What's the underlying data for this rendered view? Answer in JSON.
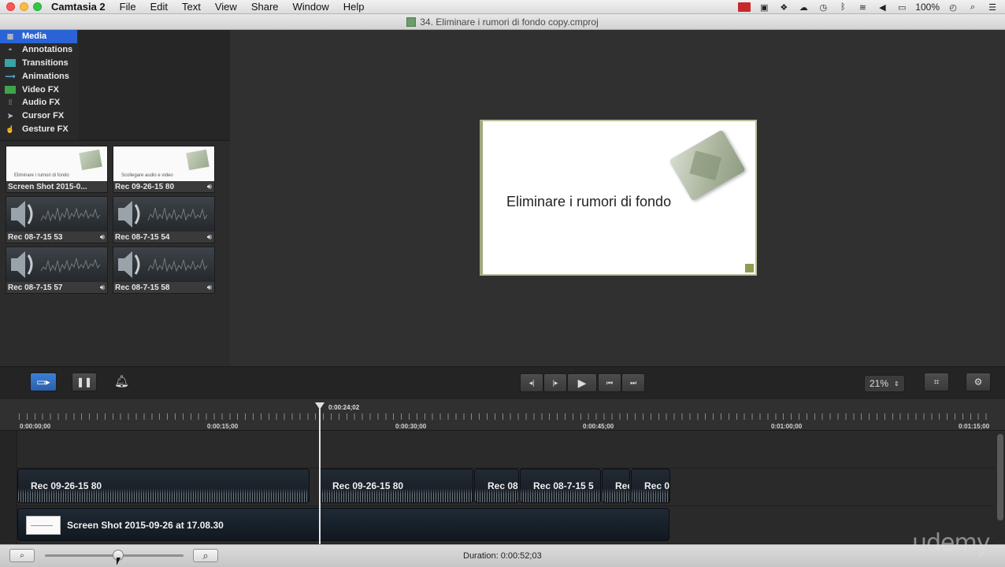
{
  "menubar": {
    "app_name": "Camtasia 2",
    "items": [
      "File",
      "Edit",
      "Text",
      "View",
      "Share",
      "Window",
      "Help"
    ],
    "battery": "100%"
  },
  "titlebar": {
    "title": "34. Eliminare i rumori di fondo copy.cmproj"
  },
  "sidebar": {
    "items": [
      {
        "label": "Media",
        "icon": "film-icon"
      },
      {
        "label": "Annotations",
        "icon": "speech-bubble-icon"
      },
      {
        "label": "Transitions",
        "icon": "transition-icon"
      },
      {
        "label": "Animations",
        "icon": "arrow-icon"
      },
      {
        "label": "Video FX",
        "icon": "video-fx-icon"
      },
      {
        "label": "Audio FX",
        "icon": "waveform-icon"
      },
      {
        "label": "Cursor FX",
        "icon": "cursor-icon"
      },
      {
        "label": "Gesture FX",
        "icon": "hand-icon"
      }
    ]
  },
  "media_bin": {
    "clips": [
      {
        "caption": "Screen Shot 2015-0...",
        "kind": "slide",
        "slide_text": "Eliminare i rumori di fondo"
      },
      {
        "caption": "Rec 09-26-15 80",
        "kind": "slide",
        "slide_text": "Scollegare audio e video"
      },
      {
        "caption": "Rec 08-7-15 53",
        "kind": "audio"
      },
      {
        "caption": "Rec 08-7-15 54",
        "kind": "audio"
      },
      {
        "caption": "Rec 08-7-15 57",
        "kind": "audio"
      },
      {
        "caption": "Rec 08-7-15 58",
        "kind": "audio"
      }
    ]
  },
  "canvas": {
    "title": "Eliminare i rumori di fondo"
  },
  "controls": {
    "zoom": "21%"
  },
  "timeline": {
    "playhead_time": "0:00:24;02",
    "ruler_labels": [
      "0:00:00;00",
      "0:00:15;00",
      "0:00:30;00",
      "0:00:45;00",
      "0:01:00;00",
      "0:01:15;00"
    ],
    "audio_clips": [
      {
        "label": "Rec 09-26-15 80"
      },
      {
        "label": "Rec 09-26-15 80"
      },
      {
        "label": "Rec 08"
      },
      {
        "label": "Rec 08-7-15 5"
      },
      {
        "label": "Rec"
      },
      {
        "label": "Rec 0"
      }
    ],
    "video_clip": {
      "label": "Screen Shot 2015-09-26 at 17.08.30"
    }
  },
  "footer": {
    "duration": "Duration: 0:00:52;03"
  },
  "watermark": "udemy"
}
